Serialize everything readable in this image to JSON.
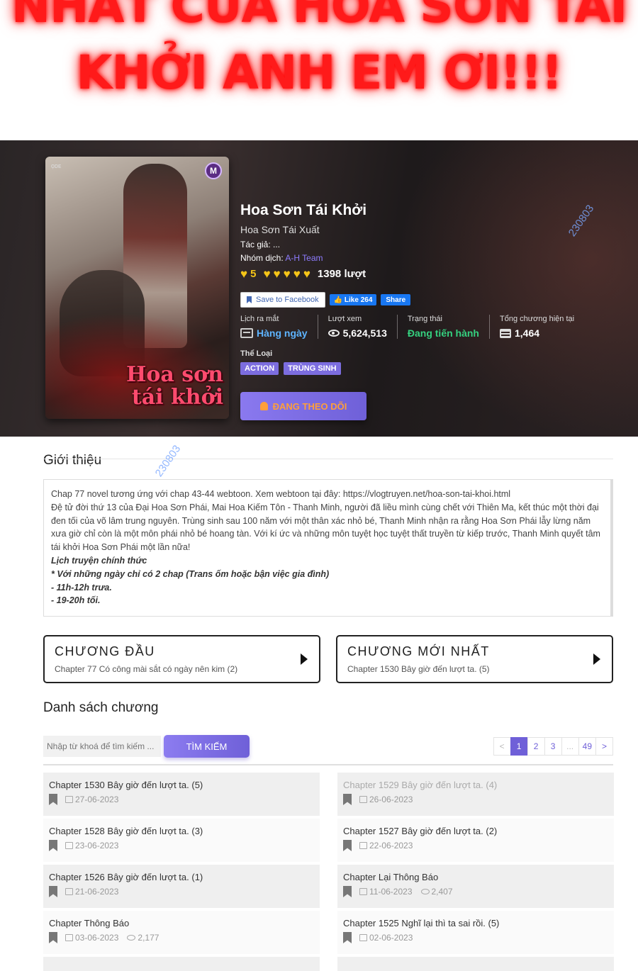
{
  "banner": {
    "line1": "NHẤT CỦA HOA SƠN TÁI",
    "line2": "KHỞI ANH EM ƠI!!!"
  },
  "cover": {
    "title_line1": "Hoa sơn",
    "title_line2": "tái khởi",
    "badge": "M",
    "logo": "ọᴅᴇ"
  },
  "manga": {
    "title": "Hoa Sơn Tái Khởi",
    "alt_title": "Hoa Sơn Tái Xuất",
    "author_label": "Tác giả: ...",
    "translator_label": "Nhóm dịch:",
    "translator": "A-H Team",
    "rating_score": "5",
    "rating_count": "1398 lượt",
    "hearts": [
      "♥",
      "♥",
      "♥",
      "♥",
      "♥",
      "♥"
    ]
  },
  "social": {
    "save_label": "Save to Facebook",
    "like_label": "👍 Like 264",
    "share_label": "Share"
  },
  "stats": {
    "release_label": "Lịch ra mắt",
    "release_value": "Hàng ngày",
    "views_label": "Lượt xem",
    "views_value": "5,624,513",
    "status_label": "Trạng thái",
    "status_value": "Đang tiến hành",
    "chapters_label": "Tổng chương hiện tại",
    "chapters_value": "1,464"
  },
  "genres": {
    "label": "Thể Loại",
    "tags": [
      "ACTION",
      "TRÙNG SINH"
    ]
  },
  "follow_label": "ĐANG THEO DÕI",
  "watermark": "230803",
  "intro": {
    "title": "Giới thiệu",
    "p1": "Chap 77 novel tương ứng với chap 43-44 webtoon. Xem webtoon tại đây: https://vlogtruyen.net/hoa-son-tai-khoi.html",
    "p2": "Đệ tử đời thứ 13 của Đại Hoa Sơn Phái, Mai Hoa Kiếm Tôn - Thanh Minh, người đã liều mình cùng chết với Thiên Ma, kết thúc một thời đại đen tối của võ lâm trung nguyên. Trùng sinh sau 100 năm với một thân xác nhỏ bé, Thanh Minh nhận ra rằng Hoa Sơn Phái lẫy lừng năm xưa giờ chỉ còn là một môn phái nhỏ bé hoang tàn. Với kí ức và những môn tuyệt học tuyệt thất truyền từ kiếp trước, Thanh Minh quyết tâm tái khởi Hoa Sơn Phái một lần nữa!",
    "s1": "Lịch truyện chính thức",
    "s2": "* Với những ngày chỉ có 2 chap (Trans ốm hoặc bận việc gia đình)",
    "s3": "- 11h-12h trưa.",
    "s4": "- 19-20h tối."
  },
  "first_chapter": {
    "heading": "CHƯƠNG ĐẦU",
    "name": "Chapter 77 Có công mài sắt có ngày nên kim (2)"
  },
  "latest_chapter": {
    "heading": "CHƯƠNG MỚI NHẤT",
    "name": "Chapter 1530 Bây giờ đến lượt ta. (5)"
  },
  "list": {
    "title": "Danh sách chương",
    "search_placeholder": "Nhập từ khoá để tìm kiếm ...",
    "search_button": "TÌM KIẾM",
    "pages": [
      "<",
      "1",
      "2",
      "3",
      "...",
      "49",
      ">"
    ],
    "chapters": [
      {
        "name": "Chapter 1530 Bây giờ đến lượt ta. (5)",
        "date": "27-06-2023",
        "views": ""
      },
      {
        "name": "Chapter 1529 Bây giờ đến lượt ta. (4)",
        "date": "26-06-2023",
        "views": ""
      },
      {
        "name": "Chapter 1528 Bây giờ đến lượt ta. (3)",
        "date": "23-06-2023",
        "views": ""
      },
      {
        "name": "Chapter 1527 Bây giờ đến lượt ta. (2)",
        "date": "22-06-2023",
        "views": ""
      },
      {
        "name": "Chapter 1526 Bây giờ đến lượt ta. (1)",
        "date": "21-06-2023",
        "views": ""
      },
      {
        "name": "Chapter Lại Thông Báo",
        "date": "11-06-2023",
        "views": "2,407"
      },
      {
        "name": "Chapter Thông Báo",
        "date": "03-06-2023",
        "views": "2,177"
      },
      {
        "name": "Chapter 1525 Nghĩ lại thì ta sai rồi. (5)",
        "date": "02-06-2023",
        "views": ""
      }
    ]
  }
}
